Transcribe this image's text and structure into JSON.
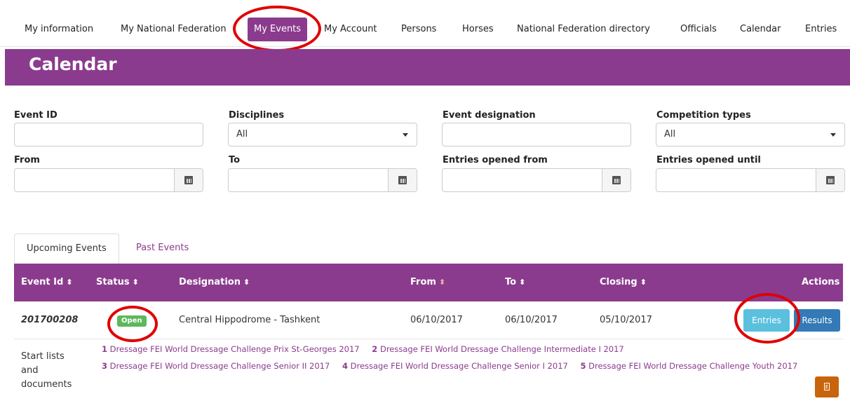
{
  "nav": {
    "items": [
      {
        "label": "My information"
      },
      {
        "label": "My National Federation"
      },
      {
        "label": "My Events"
      },
      {
        "label": "My Account"
      },
      {
        "label": "Persons"
      },
      {
        "label": "Horses"
      },
      {
        "label": "National Federation directory"
      },
      {
        "label": "Officials"
      },
      {
        "label": "Calendar"
      },
      {
        "label": "Entries"
      }
    ],
    "active": "My Events"
  },
  "page": {
    "title": "Calendar"
  },
  "filters": {
    "event_id_label": "Event ID",
    "disciplines_label": "Disciplines",
    "disciplines_value": "All",
    "event_designation_label": "Event designation",
    "competition_types_label": "Competition types",
    "competition_types_value": "All",
    "from_label": "From",
    "to_label": "To",
    "entries_opened_from_label": "Entries opened from",
    "entries_opened_until_label": "Entries opened until"
  },
  "tabs": [
    {
      "label": "Upcoming Events"
    },
    {
      "label": "Past Events"
    }
  ],
  "table": {
    "headers": {
      "event_id": "Event Id",
      "status": "Status",
      "designation": "Designation",
      "from": "From",
      "to": "To",
      "closing": "Closing",
      "actions": "Actions"
    },
    "row": {
      "event_id": "201700208",
      "status": "Open",
      "designation": "Central Hippodrome - Tashkent",
      "from": "06/10/2017",
      "to": "06/10/2017",
      "closing": "05/10/2017",
      "entries_button": "Entries",
      "results_button": "Results"
    }
  },
  "start_lists": {
    "label": "Start lists and documents",
    "links": [
      {
        "num": "1",
        "text": "Dressage FEI World Dressage Challenge Prix St-Georges 2017"
      },
      {
        "num": "2",
        "text": "Dressage FEI World Dressage Challenge Intermediate I 2017"
      },
      {
        "num": "3",
        "text": "Dressage FEI World Dressage Challenge Senior II 2017"
      },
      {
        "num": "4",
        "text": "Dressage FEI World Dressage Challenge Senior I 2017"
      },
      {
        "num": "5",
        "text": "Dressage FEI World Dressage Challenge Youth 2017"
      }
    ]
  },
  "colors": {
    "brand": "#8b3b8d",
    "open_badge": "#5cb85c",
    "entries_button": "#5bc0de",
    "results_button": "#337ab7",
    "doc_button": "#c8650c",
    "highlight_ring": "#e00000"
  },
  "icons": [
    "calendar-icon",
    "caret-down-icon",
    "sort-icon",
    "document-icon"
  ]
}
